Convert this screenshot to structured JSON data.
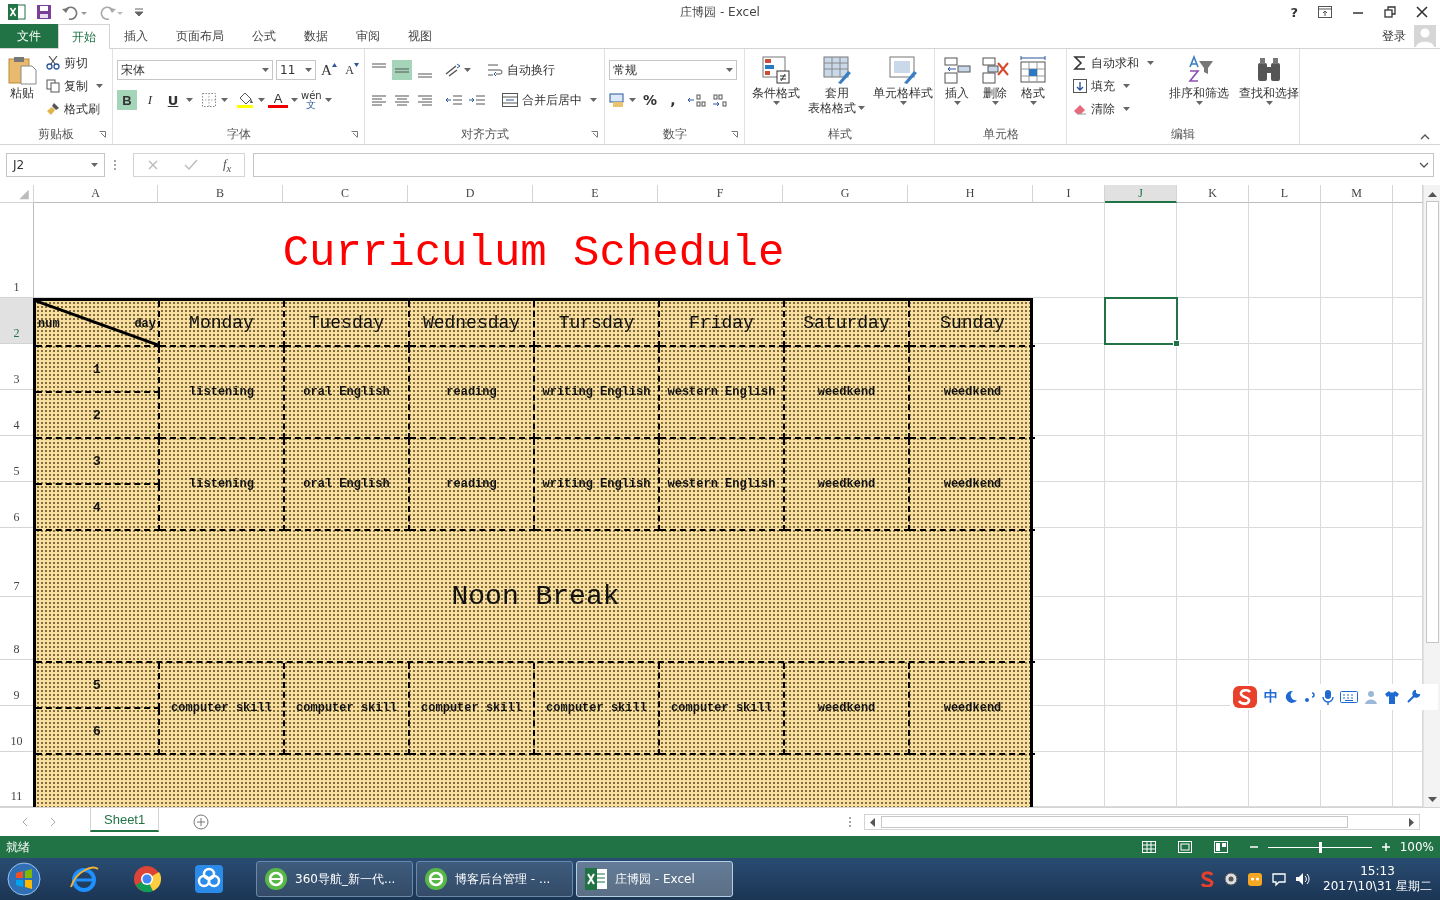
{
  "window": {
    "title": "庄博园 - Excel",
    "help": "?",
    "signin": "登录"
  },
  "tabs": [
    {
      "label": "文件",
      "kind": "file",
      "selected": false
    },
    {
      "label": "开始",
      "kind": "tab",
      "selected": true
    },
    {
      "label": "插入",
      "kind": "tab",
      "selected": false
    },
    {
      "label": "页面布局",
      "kind": "tab",
      "selected": false
    },
    {
      "label": "公式",
      "kind": "tab",
      "selected": false
    },
    {
      "label": "数据",
      "kind": "tab",
      "selected": false
    },
    {
      "label": "审阅",
      "kind": "tab",
      "selected": false
    },
    {
      "label": "视图",
      "kind": "tab",
      "selected": false
    }
  ],
  "clipboard": {
    "paste": "粘贴",
    "cut": "剪切",
    "copy": "复制",
    "format_painter": "格式刷",
    "label": "剪贴板"
  },
  "font": {
    "name": "宋体",
    "size": "11",
    "grow": "A",
    "shrink": "A",
    "bold": {
      "label": "B",
      "on": true
    },
    "italic": {
      "label": "I",
      "on": false
    },
    "underline": {
      "label": "U",
      "on": false
    },
    "color_label": "A",
    "phonetic_top": "wén",
    "phonetic_bottom": "文",
    "label": "字体"
  },
  "alignment": {
    "middle_on": true,
    "wrap": "自动换行",
    "merge": "合并后居中",
    "label": "对齐方式"
  },
  "number": {
    "format": "常规",
    "percent": "%",
    "comma": ",",
    "label": "数字"
  },
  "styles": {
    "conditional": "条件格式",
    "table_top": "套用",
    "table_bottom": "表格格式",
    "cell_styles": "单元格样式",
    "label": "样式"
  },
  "cells": {
    "insert": "插入",
    "delete": "删除",
    "format": "格式",
    "label": "单元格"
  },
  "editing": {
    "autosum": "自动求和",
    "fill": "填充",
    "clear": "清除",
    "sort": "排序和筛选",
    "find": "查找和选择",
    "label": "编辑"
  },
  "formula_bar": {
    "name_box": "J2",
    "fx": "f$_{x}$"
  },
  "columns": [
    {
      "label": "A",
      "selected": false
    },
    {
      "label": "B",
      "selected": false
    },
    {
      "label": "C",
      "selected": false
    },
    {
      "label": "D",
      "selected": false
    },
    {
      "label": "E",
      "selected": false
    },
    {
      "label": "F",
      "selected": false
    },
    {
      "label": "G",
      "selected": false
    },
    {
      "label": "H",
      "selected": false
    },
    {
      "label": "I",
      "selected": false
    },
    {
      "label": "J",
      "selected": true
    },
    {
      "label": "K",
      "selected": false
    },
    {
      "label": "L",
      "selected": false
    },
    {
      "label": "M",
      "selected": false
    }
  ],
  "rows": [
    {
      "label": "1",
      "selected": false
    },
    {
      "label": "2",
      "selected": true
    },
    {
      "label": "3",
      "selected": false
    },
    {
      "label": "4",
      "selected": false
    },
    {
      "label": "5",
      "selected": false
    },
    {
      "label": "6",
      "selected": false
    },
    {
      "label": "7",
      "selected": false
    },
    {
      "label": "8",
      "selected": false
    },
    {
      "label": "9",
      "selected": false
    },
    {
      "label": "10",
      "selected": false
    },
    {
      "label": "11",
      "selected": false
    }
  ],
  "schedule": {
    "title": "Curriculum Schedule",
    "corner_left": "num",
    "corner_right": "day",
    "days": [
      "Monday",
      "Tuesday",
      "Wednesday",
      "Tursday",
      "Friday",
      "Saturday",
      "Sunday"
    ],
    "blocks": [
      {
        "kind": "classes",
        "periods": [
          "1",
          "2"
        ],
        "subjects": [
          "listening",
          "oral English",
          "reading",
          "writing English",
          "western English",
          "weedkend",
          "weedkend"
        ]
      },
      {
        "kind": "classes",
        "periods": [
          "3",
          "4"
        ],
        "subjects": [
          "listening",
          "oral English",
          "reading",
          "writing English",
          "western English",
          "weedkend",
          "weedkend"
        ]
      },
      {
        "kind": "break",
        "label": "Noon Break"
      },
      {
        "kind": "classes",
        "periods": [
          "5",
          "6"
        ],
        "subjects": [
          "computer skill",
          "computer skill",
          "computer skill",
          "computer skill",
          "computer skill",
          "weedkend",
          "weedkend"
        ]
      }
    ]
  },
  "ime": {
    "mode": "中"
  },
  "sheet_tabs": [
    {
      "label": "Sheet1",
      "selected": true
    }
  ],
  "status_bar": {
    "text": "就绪",
    "zoom": "100%",
    "level": 0.5
  },
  "taskbar": {
    "items": [
      {
        "label": "360导航_新一代...",
        "kind": "browser",
        "selected": false
      },
      {
        "label": "博客后台管理 - ...",
        "kind": "browser",
        "selected": false
      },
      {
        "label": "庄博园 - Excel",
        "kind": "excel",
        "selected": true
      }
    ],
    "time": "15:13",
    "date": "2017\\10\\31 星期二"
  }
}
